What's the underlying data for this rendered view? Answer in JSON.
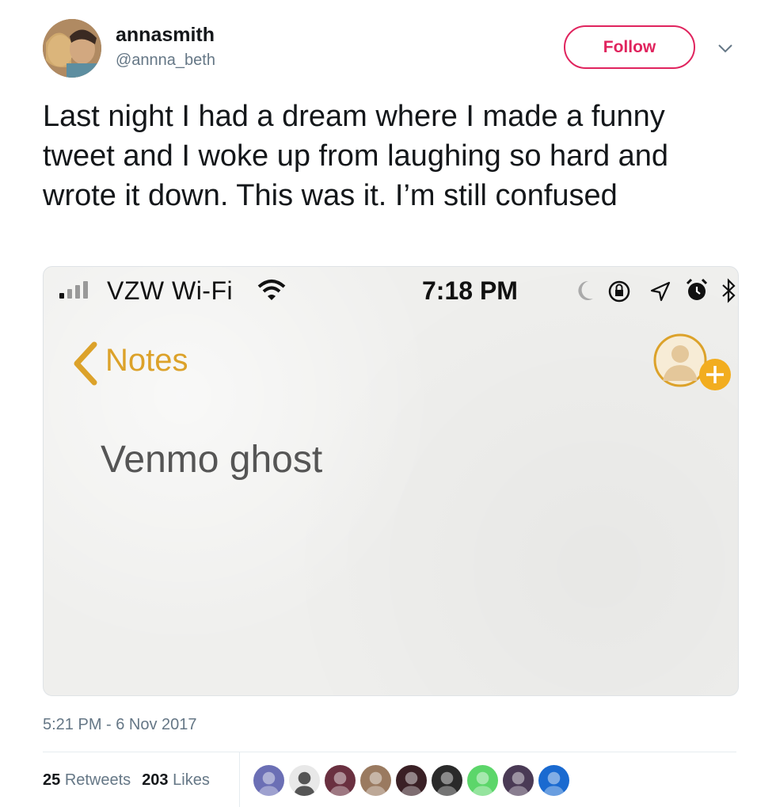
{
  "author": {
    "display_name": "annasmith",
    "handle": "@annna_beth"
  },
  "follow_button": {
    "label": "Follow"
  },
  "tweet": {
    "text": "Last night I had a dream where I made a funny tweet and I woke up from laughing so hard and wrote it down. This was it. I’m still confused"
  },
  "media": {
    "status_bar": {
      "carrier": "VZW Wi-Fi",
      "time": "7:18 PM"
    },
    "nav": {
      "back_label": "Notes"
    },
    "note_text": "Venmo ghost"
  },
  "timestamp": "5:21 PM - 6 Nov 2017",
  "stats": {
    "retweets_count": "25",
    "retweets_label": "Retweets",
    "likes_count": "203",
    "likes_label": "Likes"
  },
  "likers": [
    {
      "name": "liker-avatar",
      "color": "#6b6fb5"
    },
    {
      "name": "liker-avatar",
      "color": "#e8e8e8"
    },
    {
      "name": "liker-avatar",
      "color": "#6a3040"
    },
    {
      "name": "liker-avatar",
      "color": "#9a7a60"
    },
    {
      "name": "liker-avatar",
      "color": "#3a2025"
    },
    {
      "name": "liker-avatar",
      "color": "#2a2a2a"
    },
    {
      "name": "liker-avatar",
      "color": "#5cd66a"
    },
    {
      "name": "liker-avatar",
      "color": "#4a3a55"
    },
    {
      "name": "liker-avatar",
      "color": "#1a6ad0"
    }
  ],
  "colors": {
    "follow_accent": "#e0245e",
    "secondary_text": "#657786",
    "notes_accent": "#dca22a"
  }
}
